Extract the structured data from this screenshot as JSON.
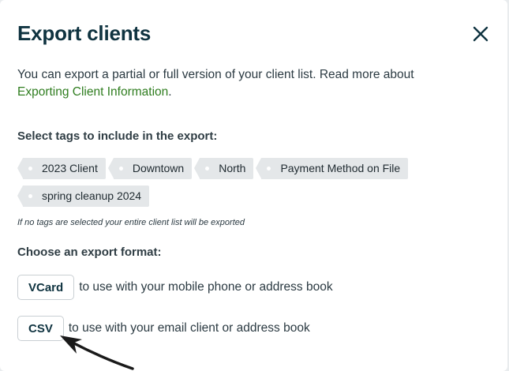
{
  "dialog": {
    "title": "Export clients",
    "close_icon": "close-icon",
    "description": "You can export a partial or full version of your client list. Read more about",
    "link_text": "Exporting Client Information",
    "link_suffix": "."
  },
  "tags_section": {
    "label": "Select tags to include in the export:",
    "tags": [
      "2023 Client",
      "Downtown",
      "North",
      "Payment Method on File",
      "spring cleanup 2024"
    ],
    "note": "If no tags are selected your entire client list will be exported"
  },
  "format_section": {
    "label": "Choose an export format:",
    "options": [
      {
        "button": "VCard",
        "description": "to use with your mobile phone or address book"
      },
      {
        "button": "CSV",
        "description": "to use with your email client or address book"
      }
    ]
  },
  "annotation": {
    "arrow_icon": "pointer-arrow-icon",
    "color": "#1a1a1a"
  }
}
